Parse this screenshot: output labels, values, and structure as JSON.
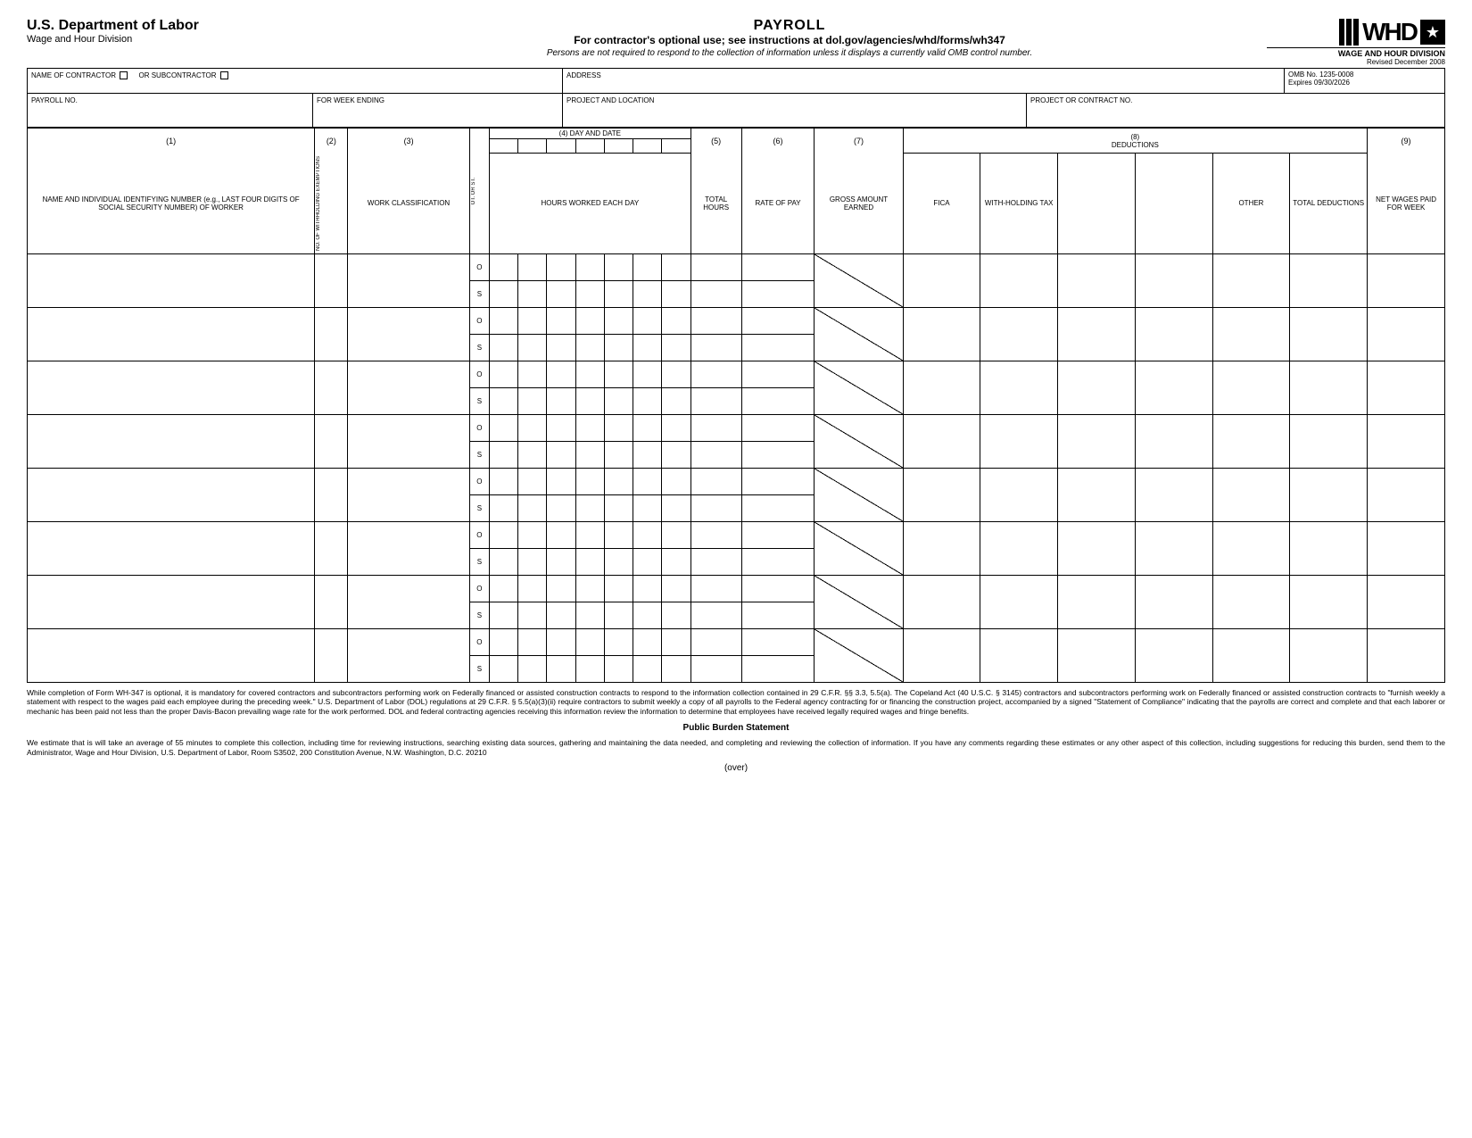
{
  "header": {
    "dept": "U.S. Department of Labor",
    "division": "Wage and Hour Division",
    "title": "PAYROLL",
    "subtitle": "For contractor's optional use; see instructions at dol.gov/agencies/whd/forms/wh347",
    "note": "Persons are not required to respond to the collection of information unless it displays a currently valid OMB control number.",
    "logo_main": "WHD",
    "logo_sub": "WAGE AND HOUR DIVISION",
    "logo_rev": "Revised December 2008"
  },
  "info": {
    "contractor_label": "NAME OF CONTRACTOR",
    "or_sub_label": "OR SUBCONTRACTOR",
    "address_label": "ADDRESS",
    "omb_line1": "OMB No. 1235-0008",
    "omb_line2": "Expires 09/30/2026",
    "payroll_no_label": "PAYROLL NO.",
    "week_ending_label": "FOR WEEK ENDING",
    "project_loc_label": "PROJECT AND LOCATION",
    "project_contract_label": "PROJECT OR CONTRACT NO."
  },
  "cols": {
    "c1": "(1)",
    "c2": "(2)",
    "c3": "(3)",
    "c4": "(4) DAY AND DATE",
    "c5": "(5)",
    "c6": "(6)",
    "c7": "(7)",
    "c8": "(8)\nDEDUCTIONS",
    "c9": "(9)",
    "h1": "NAME AND INDIVIDUAL IDENTIFYING NUMBER (e.g., LAST FOUR DIGITS OF SOCIAL SECURITY NUMBER) OF WORKER",
    "h2": "NO. OF WITHHOLDING EXEMPTIONS",
    "h3": "WORK CLASSIFICATION",
    "h_otst": "OT. OR ST.",
    "h4": "HOURS WORKED EACH DAY",
    "h5": "TOTAL HOURS",
    "h6": "RATE OF PAY",
    "h7": "GROSS AMOUNT EARNED",
    "h8a": "FICA",
    "h8b": "WITH-HOLDING TAX",
    "h8c": "",
    "h8d": "",
    "h8e": "OTHER",
    "h8f": "TOTAL DEDUCTIONS",
    "h9": "NET WAGES PAID FOR WEEK",
    "o": "O",
    "s": "S"
  },
  "footer": {
    "para1": "While completion of Form WH-347 is optional, it is mandatory for covered contractors and subcontractors performing work on Federally financed or assisted construction contracts to respond to the information collection contained in 29 C.F.R. §§ 3.3, 5.5(a). The Copeland Act (40 U.S.C. § 3145) contractors and subcontractors performing work on Federally financed or assisted construction contracts to \"furnish weekly a statement with respect to the wages paid each employee during the  preceding week.\"  U.S. Department of Labor (DOL) regulations at 29 C.F.R. § 5.5(a)(3)(ii) require contractors to submit weekly a copy of all payrolls to the Federal agency contracting for or financing the construction project, accompanied by a signed \"Statement of Compliance\" indicating that the payrolls are correct and complete and that each laborer or mechanic has been paid not less than the proper Davis-Bacon prevailing wage rate for the work performed. DOL and federal contracting agencies receiving this information review the information to determine that employees have received legally required wages and fringe benefits.",
    "burden_title": "Public Burden Statement",
    "para2": "We estimate that is will take an average of 55 minutes to complete this collection, including time for reviewing instructions, searching existing data sources, gathering and maintaining the data needed, and completing and reviewing the collection of information. If you have any comments regarding these estimates or any other aspect of this collection, including suggestions for reducing this burden, send them to the Administrator, Wage and Hour Division, U.S. Department of Labor, Room S3502, 200 Constitution Avenue, N.W. Washington, D.C. 20210",
    "over": "(over)"
  }
}
